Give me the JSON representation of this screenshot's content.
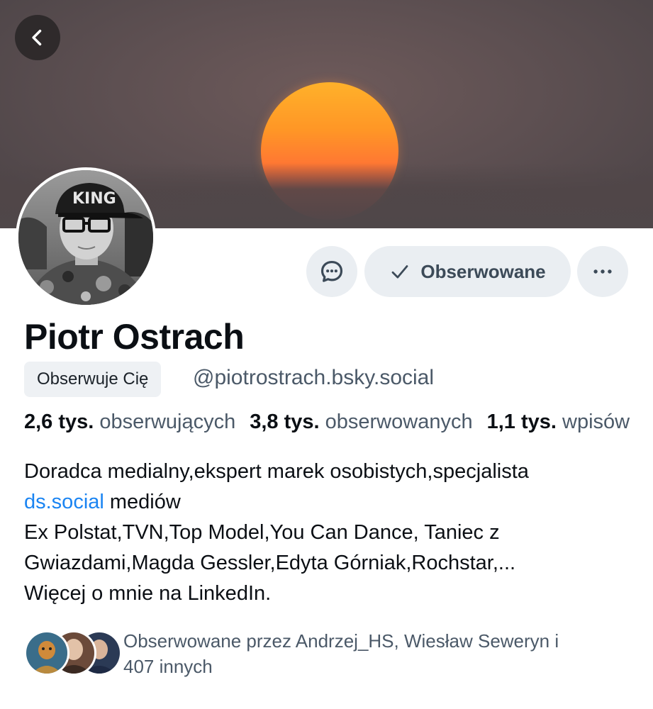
{
  "header": {
    "back_icon": "chevron-left-icon"
  },
  "profile": {
    "name": "Piotr Ostrach",
    "follows_you_badge": "Obserwuje Cię",
    "handle": "@piotrostrach.bsky.social",
    "avatar_cap_text": "KING"
  },
  "actions": {
    "message_icon": "chat-bubble-icon",
    "follow_label": "Obserwowane",
    "follow_icon": "checkmark-icon",
    "more_icon": "ellipsis-icon"
  },
  "stats": {
    "followers_count": "2,6 tys.",
    "followers_label": "obserwujących",
    "following_count": "3,8 tys.",
    "following_label": "obserwowanych",
    "posts_count": "1,1 tys.",
    "posts_label": "wpisów"
  },
  "bio": {
    "line1": "Doradca medialny,ekspert marek osobistych,specjalista",
    "link": "ds.social",
    "line2_rest": " mediów",
    "line3": "Ex Polstat,TVN,Top Model,You Can Dance, Taniec z",
    "line4": "Gwiazdami,Magda Gessler,Edyta Górniak,Rochstar,...",
    "line5": "Więcej o mnie na LinkedIn."
  },
  "followed_by": {
    "line1": "Obserwowane przez Andrzej_HS, Wiesław Seweryn i",
    "line2": "407 innych"
  },
  "colors": {
    "accent_link": "#1a84f2",
    "muted_text": "#4b5968",
    "button_bg": "#eaeef2"
  }
}
